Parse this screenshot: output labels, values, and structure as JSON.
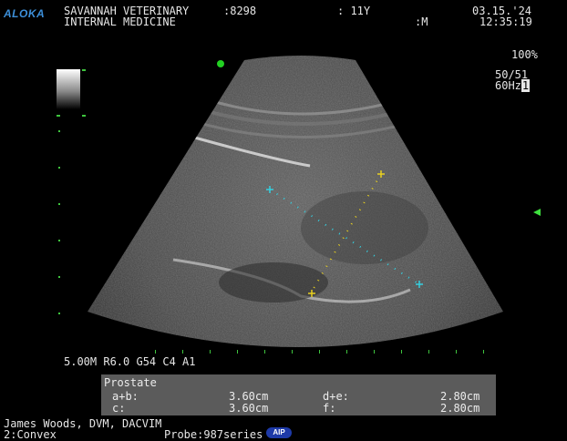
{
  "header": {
    "logo": "ALOKA",
    "facility": "SAVANNAH VETERINARY",
    "department": "INTERNAL MEDICINE",
    "patient_id": ":8298",
    "age": ": 11Y",
    "sex": ":M",
    "date": "03.15.'24",
    "time": "12:35:19"
  },
  "right_panel": {
    "gain_percent": "100%",
    "frame_rate": "50/51",
    "frequency": "60Hz",
    "frequency_suffix": "1"
  },
  "image_params": "5.00M R6.0 G54 C4 A1",
  "measurement": {
    "title": "Prostate",
    "row1_label_left": "a+b:",
    "row1_value_left": "3.60cm",
    "row1_label_right": "d+e:",
    "row1_value_right": "2.80cm",
    "row2_label_left": "c:",
    "row2_value_left": "3.60cm",
    "row2_label_right": "f:",
    "row2_value_right": "2.80cm"
  },
  "footer": {
    "operator": "James Woods, DVM, DACVIM",
    "transducer": "2:Convex",
    "probe": "Probe:987series",
    "aip_badge": "AIP"
  },
  "colors": {
    "logo": "#3d8fd9",
    "marker_green": "#3ec43e",
    "caliper_cyan": "#35d0e0",
    "caliper_yellow": "#e8d020",
    "measurement_box": "#5b5b5b"
  }
}
